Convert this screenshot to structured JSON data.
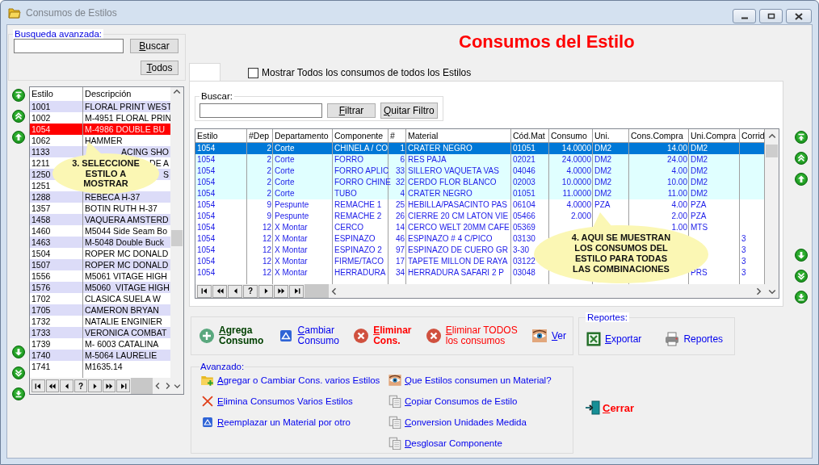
{
  "window": {
    "title": "Consumos de Estilos"
  },
  "search_panel": {
    "title": "Busqueda avanzada:",
    "buttons": [
      "Buscar",
      "Todos"
    ]
  },
  "styles_list": {
    "columns": [
      "Estilo",
      "Descripción"
    ],
    "rows": [
      {
        "estilo": "1001",
        "descripcion": "FLORAL PRINT WEST",
        "selected": false
      },
      {
        "estilo": "1002",
        "descripcion": "M-4951 FLORAL PRIN",
        "selected": false
      },
      {
        "estilo": "1054",
        "descripcion": "M-4986 DOUBLE BU",
        "selected": true
      },
      {
        "estilo": "1062",
        "descripcion": "HAMMER",
        "selected": false
      },
      {
        "estilo": "1133",
        "descripcion": "ACING SHO",
        "selected": false,
        "covered": true
      },
      {
        "estilo": "1211",
        "descripcion": "DE A",
        "selected": false,
        "covered": true
      },
      {
        "estilo": "1250",
        "descripcion": "S",
        "selected": false,
        "covered": true
      },
      {
        "estilo": "1251",
        "selected": false
      },
      {
        "estilo": "1288",
        "descripcion": "REBECA H-37",
        "selected": false
      },
      {
        "estilo": "1357",
        "descripcion": "BOTIN RUTH H-37",
        "selected": false
      },
      {
        "estilo": "1458",
        "descripcion": "VAQUERA AMSTERD",
        "selected": false
      },
      {
        "estilo": "1460",
        "descripcion": "M5044 Side Seam Bo",
        "selected": false
      },
      {
        "estilo": "1463",
        "descripcion": "M-5048 Double Buck",
        "selected": false
      },
      {
        "estilo": "1504",
        "descripcion": "ROPER MC DONALD",
        "selected": false
      },
      {
        "estilo": "1507",
        "descripcion": "ROPER MC DONALD",
        "selected": false
      },
      {
        "estilo": "1556",
        "descripcion": "M5061 VITAGE HIGH",
        "selected": false
      },
      {
        "estilo": "1576",
        "descripcion": "M5060  VITAGE HIGH",
        "selected": false
      },
      {
        "estilo": "1702",
        "descripcion": "CLASICA SUELA W",
        "selected": false
      },
      {
        "estilo": "1705",
        "descripcion": "CAMERON BRYAN",
        "selected": false
      },
      {
        "estilo": "1732",
        "descripcion": "NATALIE ENGINIER",
        "selected": false
      },
      {
        "estilo": "1733",
        "descripcion": "VERONICA COMBAT",
        "selected": false
      },
      {
        "estilo": "1739",
        "descripcion": "M- 6003 CATALINA",
        "selected": false
      },
      {
        "estilo": "1740",
        "descripcion": "M-5064 LAURELIE",
        "selected": false
      },
      {
        "estilo": "1741",
        "descripcion": "M1635.14",
        "selected": false
      }
    ],
    "callout": {
      "lines": [
        "3. SELECCIONE",
        "ESTILO A",
        "MOSTRAR"
      ]
    },
    "navigator": [
      {
        "kind": "first"
      },
      {
        "kind": "prev-page"
      },
      {
        "kind": "prev"
      },
      {
        "kind": "help",
        "label": "?"
      },
      {
        "kind": "next"
      },
      {
        "kind": "next-page"
      },
      {
        "kind": "last"
      }
    ]
  },
  "form_title": "Consumos del Estilo",
  "show_all": {
    "label": "Mostrar Todos los consumos de todos los Estilos",
    "checked": false
  },
  "filter": {
    "title": "Buscar:",
    "buttons": [
      "Filtrar",
      "Quitar Filtro"
    ]
  },
  "grid": {
    "columns": [
      {
        "label": "Estilo",
        "kind": "text"
      },
      {
        "label": "#Dep",
        "kind": "number"
      },
      {
        "label": "Departamento",
        "kind": "text"
      },
      {
        "label": "Componente",
        "kind": "text"
      },
      {
        "label": "#",
        "kind": "number"
      },
      {
        "label": "Material",
        "kind": "text"
      },
      {
        "label": "Cód.Mat",
        "kind": "text"
      },
      {
        "label": "Consumo",
        "kind": "number"
      },
      {
        "label": "Uni.",
        "kind": "text"
      },
      {
        "label": "Cons.Compra",
        "kind": "number"
      },
      {
        "label": "Uni.Compra",
        "kind": "text"
      },
      {
        "label": "Corrid",
        "kind": "text"
      }
    ],
    "rows": [
      {
        "selected": true,
        "highlighted": true,
        "cells": [
          "1054",
          "2",
          "Corte",
          "CHINELA / CO",
          "1",
          "CRATER NEGRO",
          "01051",
          "14.0000",
          "DM2",
          "14.00",
          "DM2",
          null
        ]
      },
      {
        "selected": false,
        "highlighted": true,
        "cells": [
          "1054",
          "2",
          "Corte",
          "FORRO",
          "6",
          "RES PAJA",
          "02021",
          "24.0000",
          "DM2",
          "24.00",
          "DM2",
          null
        ]
      },
      {
        "selected": false,
        "highlighted": true,
        "cells": [
          "1054",
          "2",
          "Corte",
          "FORRO APLIC",
          "33",
          "SILLERO VAQUETA VAS",
          "04046",
          "4.0000",
          "DM2",
          "4.00",
          "DM2",
          null
        ]
      },
      {
        "selected": false,
        "highlighted": true,
        "cells": [
          "1054",
          "2",
          "Corte",
          "FORRO CHINE",
          "32",
          "CERDO FLOR BLANCO",
          "02003",
          "10.0000",
          "DM2",
          "10.00",
          "DM2",
          null
        ]
      },
      {
        "selected": false,
        "highlighted": true,
        "cells": [
          "1054",
          "2",
          "Corte",
          "TUBO",
          "4",
          "CRATER NEGRO",
          "01051",
          "11.0000",
          "DM2",
          "11.00",
          "DM2",
          null
        ]
      },
      {
        "selected": false,
        "highlighted": false,
        "cells": [
          "1054",
          "9",
          "Pespunte",
          "REMACHE 1",
          "25",
          "HEBILLA/PASACINTO PAS",
          "06104",
          "4.0000",
          "PZA",
          "4.00",
          "PZA",
          null
        ]
      },
      {
        "selected": false,
        "highlighted": false,
        "cells": [
          "1054",
          "9",
          "Pespunte",
          "REMACHE 2",
          "26",
          "CIERRE 20 CM LATON VIE",
          "05466",
          "2.000",
          null,
          "2.00",
          "PZA",
          null
        ]
      },
      {
        "selected": false,
        "highlighted": false,
        "cells": [
          "1054",
          "12",
          "X Montar",
          "CERCO",
          "14",
          "CERCO WELT 20MM CAFE",
          "05369",
          null,
          null,
          "1.00",
          "MTS",
          null
        ]
      },
      {
        "selected": false,
        "highlighted": false,
        "cells": [
          "1054",
          "12",
          "X Montar",
          "ESPINAZO",
          "46",
          "ESPINAZO # 4 C/PICO",
          "03130",
          null,
          null,
          null,
          null,
          "3"
        ]
      },
      {
        "selected": false,
        "highlighted": false,
        "cells": [
          "1054",
          "12",
          "X Montar",
          "ESPINAZO 2",
          "97",
          "ESPINAZO DE CUERO GR",
          "3-30",
          null,
          null,
          null,
          null,
          "3"
        ]
      },
      {
        "selected": false,
        "highlighted": false,
        "cells": [
          "1054",
          "12",
          "X Montar",
          "FIRME/TACO",
          "17",
          "TAPETE MILLON DE RAYA",
          "03122",
          null,
          null,
          null,
          null,
          "3"
        ]
      },
      {
        "selected": false,
        "highlighted": false,
        "cells": [
          "1054",
          "12",
          "X Montar",
          "HERRADURA",
          "34",
          "HERRADURA SAFARI 2 P",
          "03048",
          null,
          null,
          null,
          "PRS",
          "3"
        ]
      }
    ],
    "callout": {
      "lines": [
        "4. AQUI SE MUESTRAN",
        "LOS CONSUMOS DEL",
        "ESTILO PARA TODAS",
        "LAS COMBINACIONES"
      ]
    },
    "navigator": [
      {
        "kind": "first"
      },
      {
        "kind": "prev-page"
      },
      {
        "kind": "prev"
      },
      {
        "kind": "help",
        "label": "?"
      },
      {
        "kind": "next"
      },
      {
        "kind": "next-page"
      },
      {
        "kind": "last"
      }
    ]
  },
  "actions": [
    {
      "kind": "add",
      "lines": [
        "Agrega",
        "Consumo"
      ]
    },
    {
      "kind": "edit",
      "lines": [
        "Cambiar",
        "Consumo"
      ]
    },
    {
      "kind": "delete",
      "lines": [
        "Eliminar",
        "Cons."
      ]
    },
    {
      "kind": "delete-all",
      "lines": [
        "Eliminar TODOS",
        "los consumos"
      ]
    },
    {
      "kind": "view",
      "lines": [
        "Ver"
      ]
    }
  ],
  "reports": {
    "title": "Reportes:",
    "items": [
      {
        "kind": "excel",
        "label": "Exportar"
      },
      {
        "kind": "print",
        "label": "Reportes"
      }
    ]
  },
  "advanced": {
    "title": "Avanzado:",
    "left": [
      {
        "kind": "folder-add",
        "label": "Agregar o Cambiar Cons. varios Estilos"
      },
      {
        "kind": "delete",
        "label": "Elimina Consumos Varios Estilos"
      },
      {
        "kind": "replace",
        "label": "Reemplazar un Material por otro"
      }
    ],
    "right": [
      {
        "kind": "view",
        "label": "Que Estilos consumen un Material?"
      },
      {
        "kind": "copy",
        "label": "Copiar Consumos de Estilo"
      },
      {
        "kind": "copy",
        "label": "Conversion Unidades Medida"
      },
      {
        "kind": "copy",
        "label": "Desglosar Componente"
      }
    ]
  },
  "close": {
    "label": "Cerrar"
  }
}
